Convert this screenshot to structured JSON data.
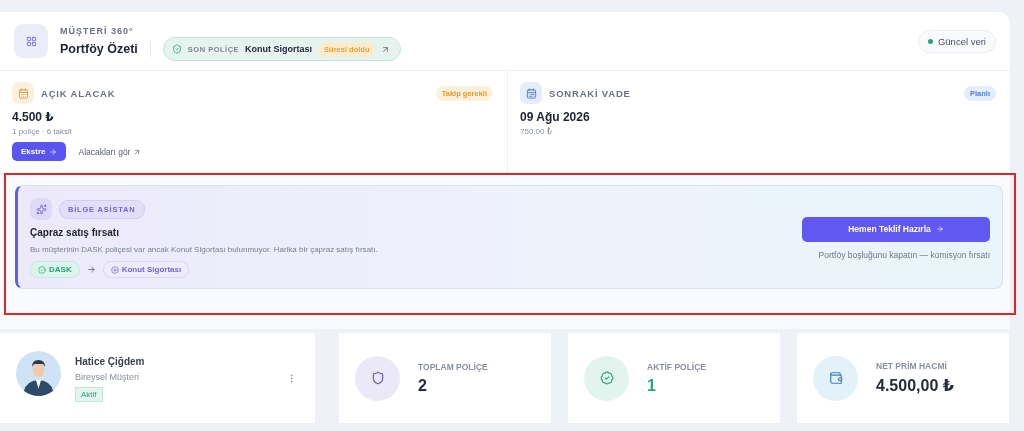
{
  "header": {
    "eyebrow": "MÜŞTERİ 360°",
    "title": "Portföy Özeti",
    "last_policy": {
      "label": "SON POLİÇE",
      "name": "Konut Sigortası",
      "status": "Süresi doldu"
    },
    "live_badge": "Güncel veri"
  },
  "metrics": [
    {
      "kind": "receivable",
      "label": "AÇIK ALACAK",
      "tag": "Takip gerekli",
      "value": "4.500 ₺",
      "sub": "1 poliçe · 6 taksit",
      "action": "Ekstre",
      "link": "Alacakları gör"
    },
    {
      "kind": "due",
      "label": "SONRAKİ VADE",
      "tag": "Planlı",
      "value": "09 Ağu 2026",
      "sub": "750,00 ₺"
    }
  ],
  "assistant": {
    "badge": "BİLGE ASİSTAN",
    "title": "Çapraz satış fırsatı",
    "message": "Bu müşterinin DASK poliçesi var ancak Konut Sigortası bulunmuyor. Harika bir çapraz satış fırsatı.",
    "from": "DASK",
    "to": "Konut Sigortası",
    "cta": "Hemen Teklif Hazırla",
    "cta_note": "Portföy boşluğunu kapatın — komisyon fırsatı"
  },
  "customer": {
    "name": "Hatice Çiğdem",
    "type": "Bireysel Müşteri",
    "status": "Aktif"
  },
  "stats": [
    {
      "kind": "total",
      "label": "TOPLAM POLİÇE",
      "value": "2"
    },
    {
      "kind": "active",
      "label": "AKTİF POLİÇE",
      "value": "1"
    },
    {
      "kind": "volume",
      "label": "NET PRİM HACMİ",
      "value": "4.500,00 ₺"
    }
  ]
}
